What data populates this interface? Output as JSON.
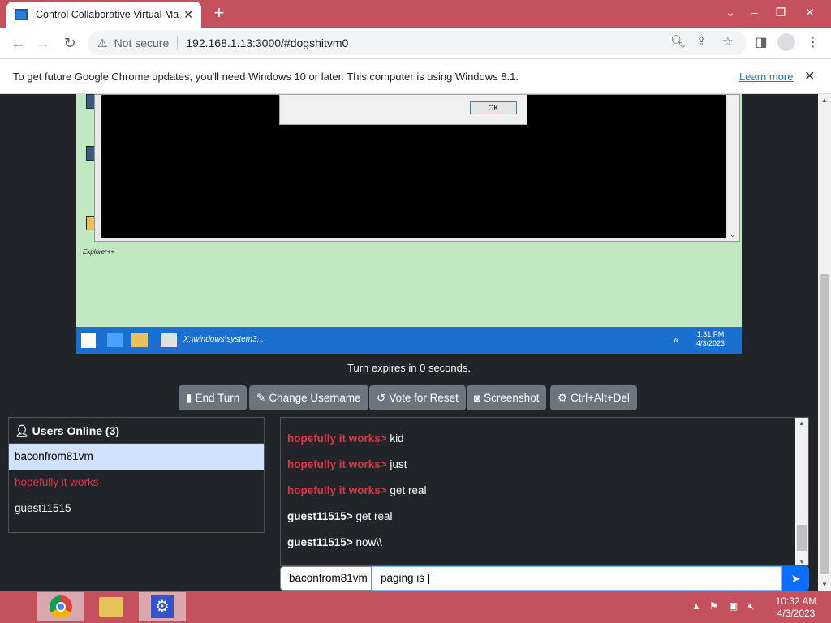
{
  "browser": {
    "tab_title": "Control Collaborative Virtual Mac",
    "security_label": "Not secure",
    "url": "192.168.1.13:3000/#dogshitvm0",
    "infobar_message": "To get future Google Chrome updates, you'll need Windows 10 or later. This computer is using Windows 8.1.",
    "infobar_link": "Learn more"
  },
  "vm_screen": {
    "dialog_ok": "OK",
    "desktop_label": "Explorer++",
    "taskbar_window": "X:\\windows\\system3...",
    "clock_time": "1:31 PM",
    "clock_date": "4/3/2023"
  },
  "turn_status": "Turn expires in 0 seconds.",
  "controls": {
    "end_turn": "End Turn",
    "change_username": "Change Username",
    "vote_reset": "Vote for Reset",
    "screenshot": "Screenshot",
    "ctrl_alt_del": "Ctrl+Alt+Del"
  },
  "users_panel": {
    "heading": "Users Online (3)",
    "users": [
      {
        "name": "baconfrom81vm"
      },
      {
        "name": "hopefully it works"
      },
      {
        "name": "guest11515"
      }
    ]
  },
  "chat": {
    "messages": [
      {
        "user": "hopefully it works>",
        "text": "kid"
      },
      {
        "user": "hopefully it works>",
        "text": "just"
      },
      {
        "user": "hopefully it works>",
        "text": "get real"
      },
      {
        "user": "guest11515>",
        "text": "get real"
      },
      {
        "user": "guest11515>",
        "text": "now\\\\"
      }
    ],
    "username_value": "baconfrom81vm",
    "message_value": "paging is |"
  },
  "host_taskbar": {
    "time": "10:32 AM",
    "date": "4/3/2023"
  }
}
